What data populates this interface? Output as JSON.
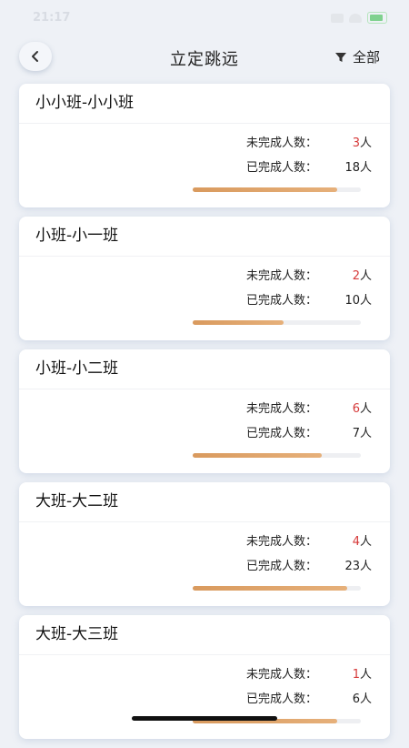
{
  "status": {
    "time": "21:17"
  },
  "header": {
    "title": "立定跳远",
    "filter_label": "全部"
  },
  "labels": {
    "incomplete": "未完成人数：",
    "complete": "已完成人数：",
    "unit": "人"
  },
  "classes": [
    {
      "name": "小小班-小小班",
      "incomplete": "3",
      "complete": "18",
      "progress": 0.86
    },
    {
      "name": "小班-小一班",
      "incomplete": "2",
      "complete": "10",
      "progress": 0.54
    },
    {
      "name": "小班-小二班",
      "incomplete": "6",
      "complete": "7",
      "progress": 0.77
    },
    {
      "name": "大班-大二班",
      "incomplete": "4",
      "complete": "23",
      "progress": 0.92
    },
    {
      "name": "大班-大三班",
      "incomplete": "1",
      "complete": "6",
      "progress": 0.86
    }
  ],
  "colors": {
    "accent": "#d99a5e",
    "incomplete_num": "#d63a3a"
  }
}
